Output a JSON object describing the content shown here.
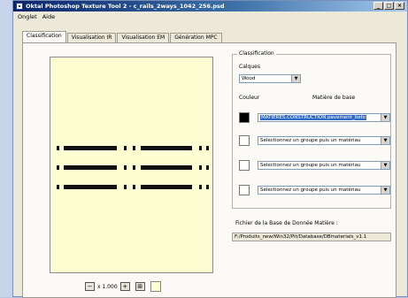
{
  "window": {
    "title": "Oktal Photoshop Texture Tool 2 - c_rails_2ways_1042_256.psd",
    "controls": [
      "_",
      "□",
      "×"
    ]
  },
  "menu": [
    "Onglet",
    "Aide"
  ],
  "tabs": [
    {
      "label": "Classification",
      "active": true
    },
    {
      "label": "Visualisation IR",
      "active": false
    },
    {
      "label": "Visualisation EM",
      "active": false
    },
    {
      "label": "Génération MPC",
      "active": false
    }
  ],
  "classification": {
    "group_title": "Classification",
    "calques_label": "Calques",
    "calques_value": "Wood",
    "couleur_label": "Couleur",
    "matiere_label": "Matière de base",
    "rows": [
      {
        "color": "#000000",
        "value": "MATIERES.CONSTRUCTION.pavement_beto",
        "selected": true
      },
      {
        "color": "#ffffff",
        "value": "Selectionnez un groupe puis un matériau",
        "selected": false
      },
      {
        "color": "#ffffff",
        "value": "Selectionnez un groupe puis un matériau",
        "selected": false
      },
      {
        "color": "#ffffff",
        "value": "Selectionnez un groupe puis un matériau",
        "selected": false
      }
    ]
  },
  "database": {
    "label": "Fichier de la Base de Donnée Matière :",
    "path": "F:/Produits_new/Win32/Pit/Database/DBmaterials_v1.1"
  },
  "zoom": {
    "minus": "−",
    "value": "x 1.000",
    "plus": "+",
    "fit": "⊞"
  },
  "colors": {
    "preview_bg": "#fefed3",
    "selection": "#316ac5"
  }
}
